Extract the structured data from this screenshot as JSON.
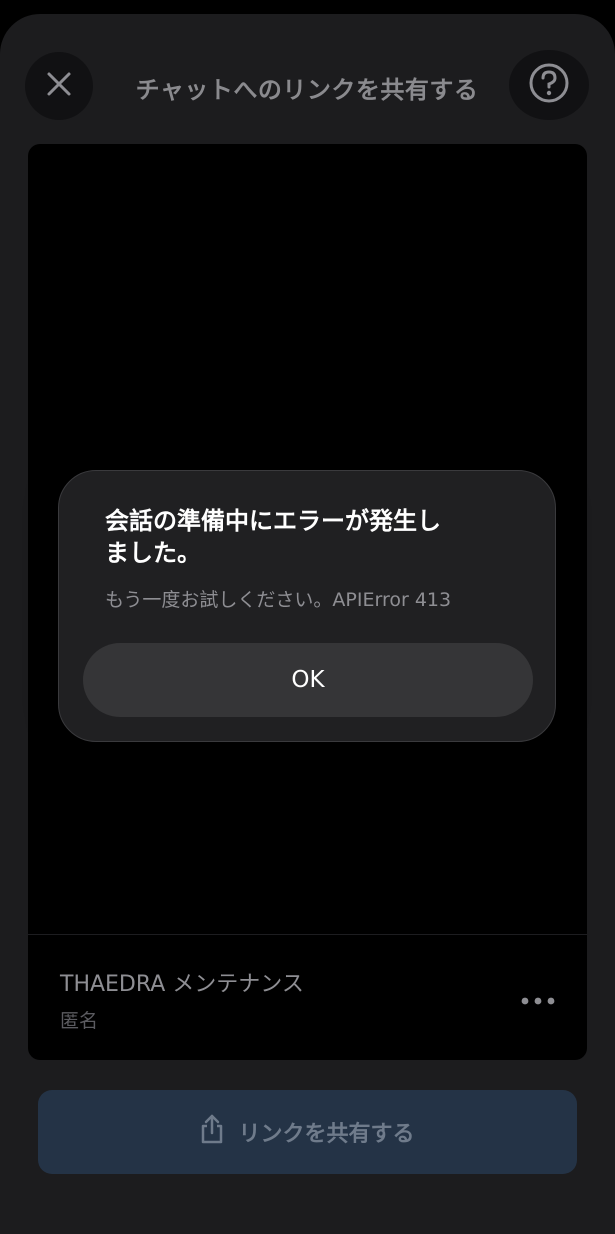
{
  "header": {
    "title": "チャットへのリンクを共有する",
    "close_icon": "close-icon",
    "help_icon": "question-circle-icon"
  },
  "preview": {
    "chat_name": "THAEDRA メンテナンス",
    "owner": "匿名",
    "more_icon": "more-horizontal-icon"
  },
  "share_button": {
    "label": "リンクを共有する",
    "icon": "share-icon",
    "color": "#243346"
  },
  "dialog": {
    "title": "会話の準備中にエラーが発生しました。",
    "message": "もう一度お試しください。APIError 413",
    "ok_label": "OK"
  }
}
